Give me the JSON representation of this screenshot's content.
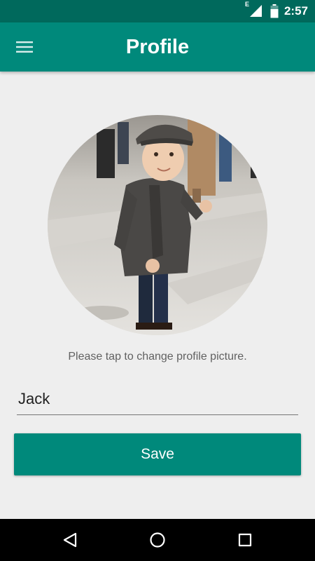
{
  "status_bar": {
    "network_type": "E",
    "clock": "2:57",
    "icons": [
      "signal-icon",
      "battery-icon"
    ]
  },
  "app_bar": {
    "title": "Profile",
    "menu_icon": "hamburger-menu-icon"
  },
  "profile": {
    "avatar_description": "profile-photo",
    "hint": "Please tap to change profile picture.",
    "name_value": "Jack",
    "name_placeholder": ""
  },
  "actions": {
    "save_label": "Save"
  },
  "nav_bar": {
    "icons": [
      "back-icon",
      "home-icon",
      "recents-icon"
    ]
  },
  "colors": {
    "status_bar": "#00695c",
    "primary": "#00897b",
    "background": "#eeeeee",
    "hint_text": "#616161"
  }
}
